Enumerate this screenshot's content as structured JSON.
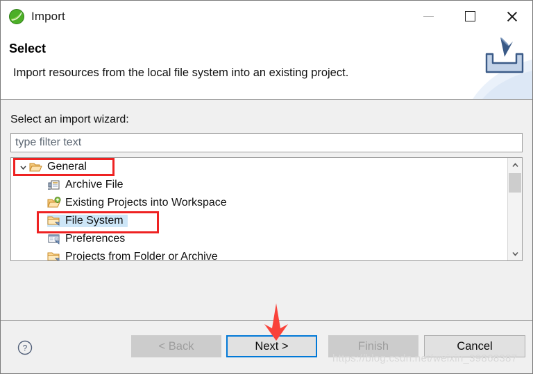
{
  "window": {
    "title": "Import",
    "app_icon": "eclipse-icon",
    "controls": [
      {
        "name": "minimize-button",
        "glyph": "minimize-icon"
      },
      {
        "name": "maximize-button",
        "glyph": "maximize-icon"
      },
      {
        "name": "close-button",
        "glyph": "close-icon"
      }
    ]
  },
  "header": {
    "title": "Select",
    "description": "Import resources from the local file system into an existing project.",
    "banner_icon": "import-tray-icon"
  },
  "main": {
    "wizard_label": "Select an import wizard:",
    "filter": {
      "value": "",
      "placeholder": "type filter text"
    },
    "tree": {
      "root": {
        "label": "General",
        "icon": "open-folder-icon",
        "expander": "chevron-down-icon",
        "expanded": true
      },
      "items": [
        {
          "label": "Archive File",
          "icon": "archive-file-icon",
          "selected": false
        },
        {
          "label": "Existing Projects into Workspace",
          "icon": "folder-import-icon",
          "selected": false
        },
        {
          "label": "File System",
          "icon": "folder-icon",
          "selected": true
        },
        {
          "label": "Preferences",
          "icon": "preferences-icon",
          "selected": false
        },
        {
          "label": "Projects from Folder or Archive",
          "icon": "folder-icon",
          "selected": false
        }
      ]
    },
    "scrollbar": {
      "up_arrow": "chevron-up-icon",
      "down_arrow": "chevron-down-icon"
    }
  },
  "footer": {
    "help_icon": "help-circle-icon",
    "buttons": [
      {
        "label": "< Back",
        "state": "disabled"
      },
      {
        "label": "Next >",
        "state": "focused"
      },
      {
        "label": "Finish",
        "state": "disabled"
      },
      {
        "label": "Cancel",
        "state": "normal"
      }
    ]
  },
  "annotations": {
    "accent_color": "#ee2222",
    "boxes": [
      {
        "target": "general-row"
      },
      {
        "target": "file-system-row"
      }
    ],
    "arrow": {
      "target": "next-button",
      "direction": "down"
    },
    "watermark": "https://blog.csdn.net/weixin_39868387"
  },
  "colors": {
    "selection": "#cde6f7",
    "focus_border": "#0078d7",
    "dialog_bg": "#f0f0f0"
  }
}
